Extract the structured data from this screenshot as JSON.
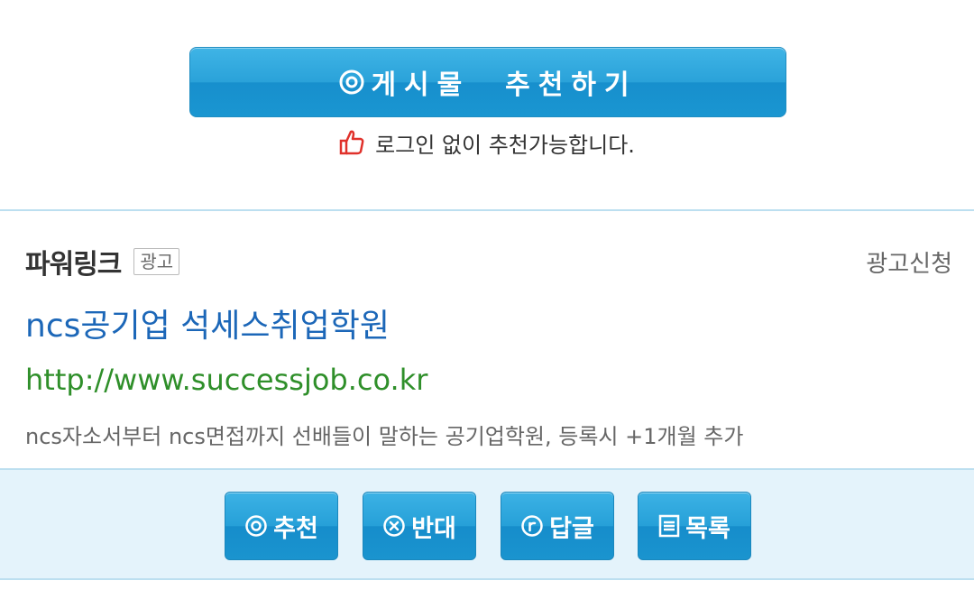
{
  "recommend": {
    "icon": "circle-dot-icon",
    "label": "게시물  추천하기",
    "note_icon": "thumbs-up-icon",
    "note": "로그인 없이 추천가능합니다."
  },
  "ad": {
    "title": "파워링크",
    "badge": "광고",
    "apply_label": "광고신청",
    "link_title": "ncs공기업 석세스취업학원",
    "url": "http://www.successjob.co.kr",
    "description": "ncs자소서부터 ncs면접까지 선배들이 말하는 공기업학원, 등록시 +1개월 추가"
  },
  "actions": [
    {
      "icon": "circle-dot-icon",
      "label": "추천"
    },
    {
      "icon": "circle-x-icon",
      "label": "반대"
    },
    {
      "icon": "circle-r-icon",
      "label": "답글"
    },
    {
      "icon": "list-icon",
      "label": "목록"
    }
  ],
  "colors": {
    "button_blue": "#1a96d1",
    "link_blue": "#1c67b8",
    "url_green": "#2f8f2a",
    "bar_bg": "#e4f3fb",
    "thumb_red": "#e0312b"
  }
}
